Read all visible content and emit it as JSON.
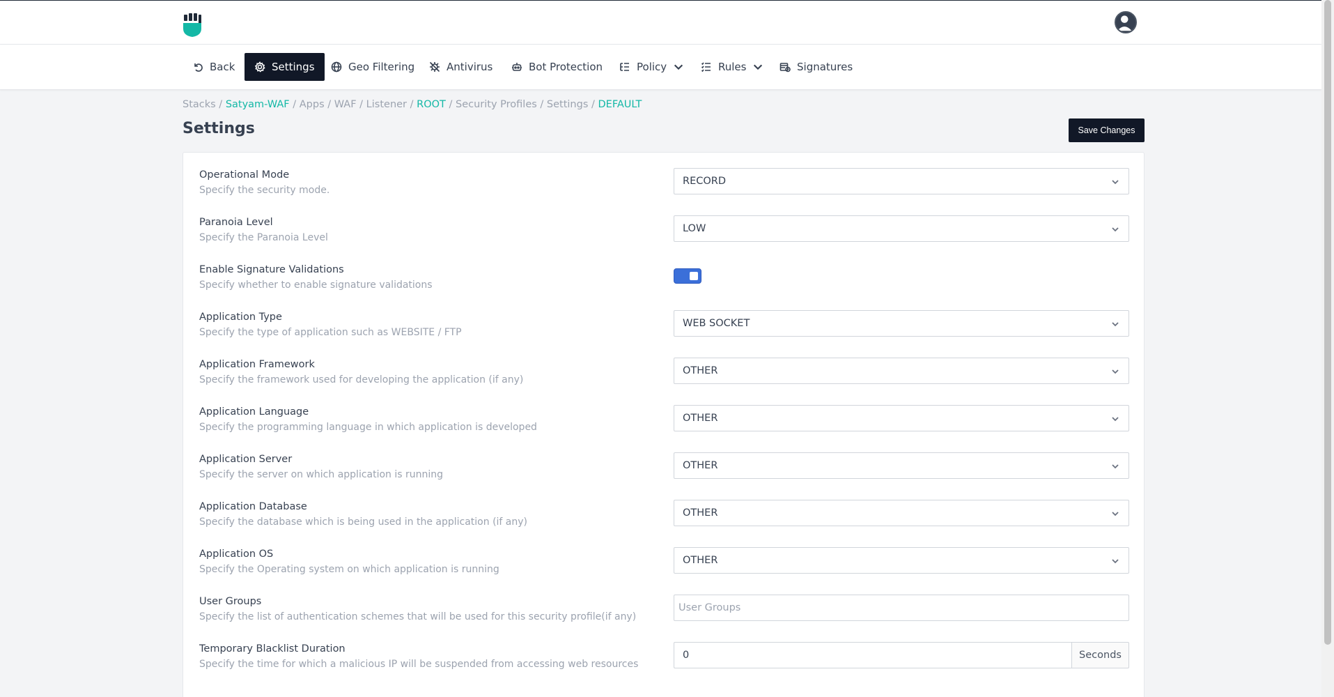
{
  "nav": {
    "back": "Back",
    "settings": "Settings",
    "geo": "Geo Filtering",
    "antivirus": "Antivirus",
    "bot": "Bot Protection",
    "policy": "Policy",
    "rules": "Rules",
    "signatures": "Signatures"
  },
  "breadcrumb": {
    "items": [
      "Stacks",
      "Satyam-WAF",
      "Apps",
      "WAF",
      "Listener",
      "ROOT",
      "Security Profiles",
      "Settings",
      "DEFAULT"
    ],
    "sep": " / "
  },
  "page": {
    "title": "Settings",
    "save_label": "Save Changes"
  },
  "fields": {
    "op_mode": {
      "label": "Operational Mode",
      "desc": "Specify the security mode.",
      "value": "RECORD"
    },
    "paranoia": {
      "label": "Paranoia Level",
      "desc": "Specify the Paranoia Level",
      "value": "LOW"
    },
    "sig_val": {
      "label": "Enable Signature Validations",
      "desc": "Specify whether to enable signature validations",
      "enabled": true
    },
    "app_type": {
      "label": "Application Type",
      "desc": "Specify the type of application such as WEBSITE / FTP",
      "value": "WEB SOCKET"
    },
    "app_framework": {
      "label": "Application Framework",
      "desc": "Specify the framework used for developing the application (if any)",
      "value": "OTHER"
    },
    "app_language": {
      "label": "Application Language",
      "desc": "Specify the programming language in which application is developed",
      "value": "OTHER"
    },
    "app_server": {
      "label": "Application Server",
      "desc": "Specify the server on which application is running",
      "value": "OTHER"
    },
    "app_db": {
      "label": "Application Database",
      "desc": "Specify the database which is being used in the application (if any)",
      "value": "OTHER"
    },
    "app_os": {
      "label": "Application OS",
      "desc": "Specify the Operating system on which application is running",
      "value": "OTHER"
    },
    "user_groups": {
      "label": "User Groups",
      "desc": "Specify the list of authentication schemes that will be used for this security profile(if any)",
      "placeholder": "User Groups"
    },
    "blacklist": {
      "label": "Temporary Blacklist Duration",
      "desc": "Specify the time for which a malicious IP will be suspended from accessing web resources",
      "value": "0",
      "unit": "Seconds"
    }
  }
}
